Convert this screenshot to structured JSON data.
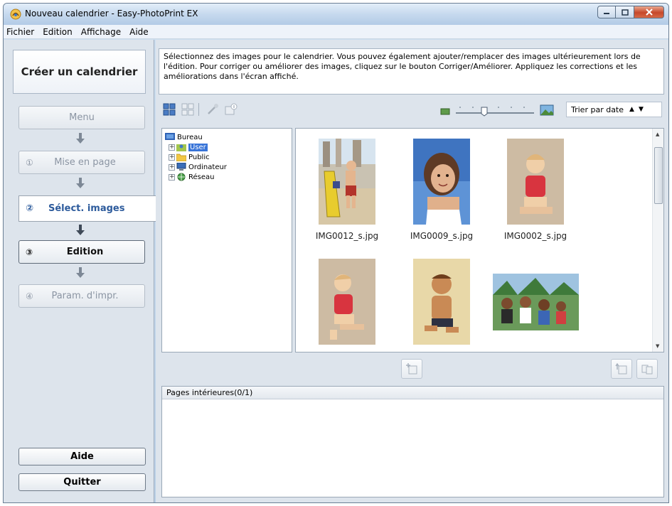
{
  "window": {
    "title": "Nouveau calendrier - Easy-PhotoPrint EX",
    "controls": [
      "minimize",
      "maximize",
      "close"
    ]
  },
  "menu": [
    "Fichier",
    "Edition",
    "Affichage",
    "Aide"
  ],
  "sidebar": {
    "header": "Créer un calendrier",
    "steps": [
      {
        "num": "",
        "label": "Menu",
        "state": "disabled"
      },
      {
        "num": "①",
        "label": "Mise en page",
        "state": "disabled"
      },
      {
        "num": "②",
        "label": "Sélect. images",
        "state": "active"
      },
      {
        "num": "③",
        "label": "Edition",
        "state": "enabled"
      },
      {
        "num": "④",
        "label": "Param. d'impr.",
        "state": "disabled"
      }
    ],
    "help_label": "Aide",
    "quit_label": "Quitter"
  },
  "instructions": "Sélectionnez des images pour le calendrier. Vous pouvez également ajouter/remplacer des images ultérieurement lors de l'édition. Pour corriger ou améliorer des images, cliquez sur le bouton Corriger/Améliorer. Appliquez les corrections et les améliorations dans l'écran affiché.",
  "toolbar": {
    "sort_label": "Trier par date",
    "zoom_level": 0.35
  },
  "tree": {
    "root": "Bureau",
    "children": [
      "User",
      "Public",
      "Ordinateur",
      "Réseau"
    ],
    "selected": "User"
  },
  "thumbnails": [
    {
      "filename": "IMG0012_s.jpg"
    },
    {
      "filename": "IMG0009_s.jpg"
    },
    {
      "filename": "IMG0002_s.jpg"
    },
    {
      "filename": ""
    },
    {
      "filename": ""
    },
    {
      "filename": ""
    }
  ],
  "pages_panel": {
    "header": "Pages intérieures(0/1)"
  },
  "colors": {
    "active_step_text": "#2d5b9c",
    "selection": "#3874d8",
    "close_button": "#c6482a"
  }
}
